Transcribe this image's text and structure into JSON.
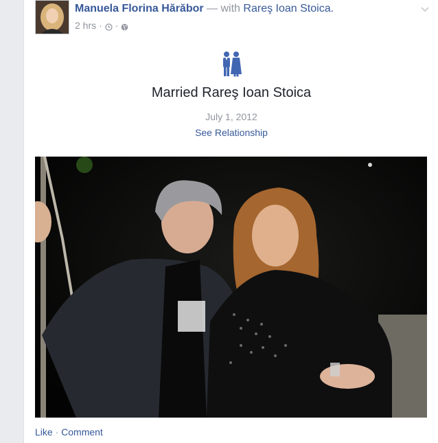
{
  "post": {
    "author": "Manuela Florina Hărăbor",
    "with_prefix": "— with",
    "tagged": "Rareş Ioan Stoica.",
    "time": "2 hrs",
    "meta_sep": "·"
  },
  "life_event": {
    "icon": "married-couple-icon",
    "title": "Married Rareş Ioan Stoica",
    "date": "July 1, 2012",
    "link": "See Relationship"
  },
  "actions": {
    "like": "Like",
    "sep": "·",
    "comment": "Comment"
  },
  "colors": {
    "link": "#365899",
    "muted": "#90949c",
    "icon_blue": "#4267b2"
  }
}
